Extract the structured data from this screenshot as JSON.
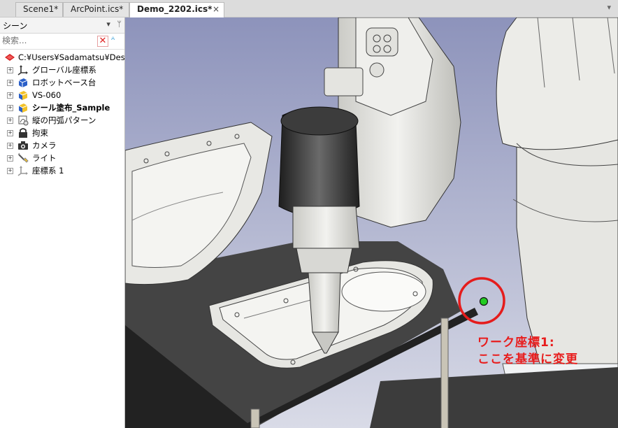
{
  "tabs": [
    {
      "label": "Scene1*",
      "active": false
    },
    {
      "label": "ArcPoint.ics*",
      "active": false
    },
    {
      "label": "Demo_2202.ics*",
      "active": true
    }
  ],
  "tab_close": "×",
  "tab_scroll": "▾",
  "panel": {
    "title": "シーン",
    "pin": "ᛘ",
    "search_placeholder": "検索...",
    "search_value": "",
    "clear": "✕",
    "filter": "ᴬ"
  },
  "tree": {
    "root": "C:¥Users¥Sadamatsu¥Desktop",
    "items": [
      {
        "label": "グローバル座標系",
        "icon": "axis-icon",
        "bold": false
      },
      {
        "label": "ロボットベース台",
        "icon": "cube-blue-icon",
        "bold": false
      },
      {
        "label": "VS-060",
        "icon": "cube-blue-yellow-icon",
        "bold": false
      },
      {
        "label": "シール塗布_Sample",
        "icon": "cube-blue-yellow-icon",
        "bold": true
      },
      {
        "label": "縦の円弧パターン",
        "icon": "arc-pattern-icon",
        "bold": false
      },
      {
        "label": "拘束",
        "icon": "lock-icon",
        "bold": false
      },
      {
        "label": "カメラ",
        "icon": "camera-icon",
        "bold": false
      },
      {
        "label": "ライト",
        "icon": "light-icon",
        "bold": false
      },
      {
        "label": "座標系 1",
        "icon": "axis-gray-icon",
        "bold": false
      }
    ]
  },
  "annotation": {
    "line1": "ワーク座標1:",
    "line2": "ここを基準に変更",
    "color": "#e81c1c",
    "marker_color": "#22cc22"
  },
  "colors": {
    "viewport_bg_top": "#9aa0c4",
    "viewport_bg_bottom": "#d7d9e6",
    "table": "#404040",
    "part": "#e9e9e6"
  }
}
